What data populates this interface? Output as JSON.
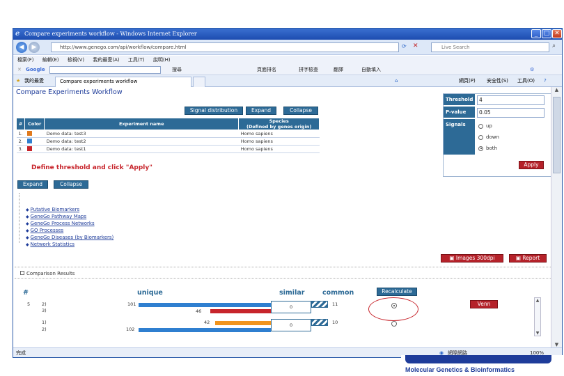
{
  "window": {
    "title": "Compare experiments workflow - Windows Internet Explorer",
    "url": "http://www.genego.com/api/workflow/compare.html",
    "search_placeholder": "Live Search"
  },
  "menubar": [
    "檔案(F)",
    "編輯(E)",
    "檢視(V)",
    "我的最愛(A)",
    "工具(T)",
    "說明(H)"
  ],
  "googlebar": {
    "brand": "Google",
    "items": [
      "搜尋",
      "頁面排名",
      "拼字檢查",
      "翻譯",
      "自動填入"
    ]
  },
  "tabs": {
    "favorites_label": "我的最愛",
    "active_tab": "Compare experiments workflow",
    "toolbar_items": [
      "網頁(P)",
      "安全性(S)",
      "工具(O)"
    ]
  },
  "page": {
    "heading": "Compare Experiments Workflow",
    "buttons": {
      "signal_distribution": "Signal distribution",
      "expand": "Expand",
      "collapse": "Collapse",
      "expand2": "Expand",
      "collapse2": "Collapse",
      "apply": "Apply",
      "images": "Images 300dpi",
      "report": "Report",
      "recalculate": "Recalculate",
      "venn": "Venn"
    },
    "table": {
      "headers": [
        "#",
        "Color",
        "Experiment name",
        "Species\n(Defined by genes origin)"
      ],
      "rows": [
        {
          "num": "1.",
          "color": "#e07a1e",
          "name": "Demo data: test3",
          "species": "Homo sapiens"
        },
        {
          "num": "2.",
          "color": "#2f7fd0",
          "name": "Demo data: test2",
          "species": "Homo sapiens"
        },
        {
          "num": "3.",
          "color": "#c7242b",
          "name": "Demo data: test1",
          "species": "Homo sapiens"
        }
      ]
    },
    "instruction": "Define threshold and click \"Apply\"",
    "links": [
      "Putative Biomarkers",
      "GeneGo Pathway Maps",
      "GeneGo Process Networks",
      "GO Processes",
      "GeneGo Diseases (by Biomarkers)",
      "Network Statistics"
    ],
    "side_panel": {
      "threshold_label": "Threshold",
      "threshold_value": "4",
      "pvalue_label": "P-value",
      "pvalue_value": "0.05",
      "signals_label": "Signals",
      "signals_options": [
        "up",
        "down",
        "both"
      ],
      "signals_selected": "both"
    },
    "comparison": {
      "title": "Comparison Results",
      "col_hash": "#",
      "col_unique": "unique",
      "col_similar": "similar",
      "col_common": "common",
      "groups": [
        {
          "ids": [
            "2)",
            "3)"
          ],
          "unique_values": [
            101,
            46
          ],
          "colors": [
            "#2f7fd0",
            "#c7242b"
          ],
          "similar": "0",
          "common": "11"
        },
        {
          "ids": [
            "1)",
            "2)"
          ],
          "unique_values": [
            42,
            102
          ],
          "colors": [
            "#f0941e",
            "#2f7fd0"
          ],
          "similar": "0",
          "common": "10"
        }
      ],
      "row_number": "5"
    }
  },
  "statusbar": {
    "left": "完成",
    "zone": "網際網路",
    "zoom": "100%"
  },
  "footer": {
    "logo_text": "Molecular Genetics & Bioinformatics"
  }
}
